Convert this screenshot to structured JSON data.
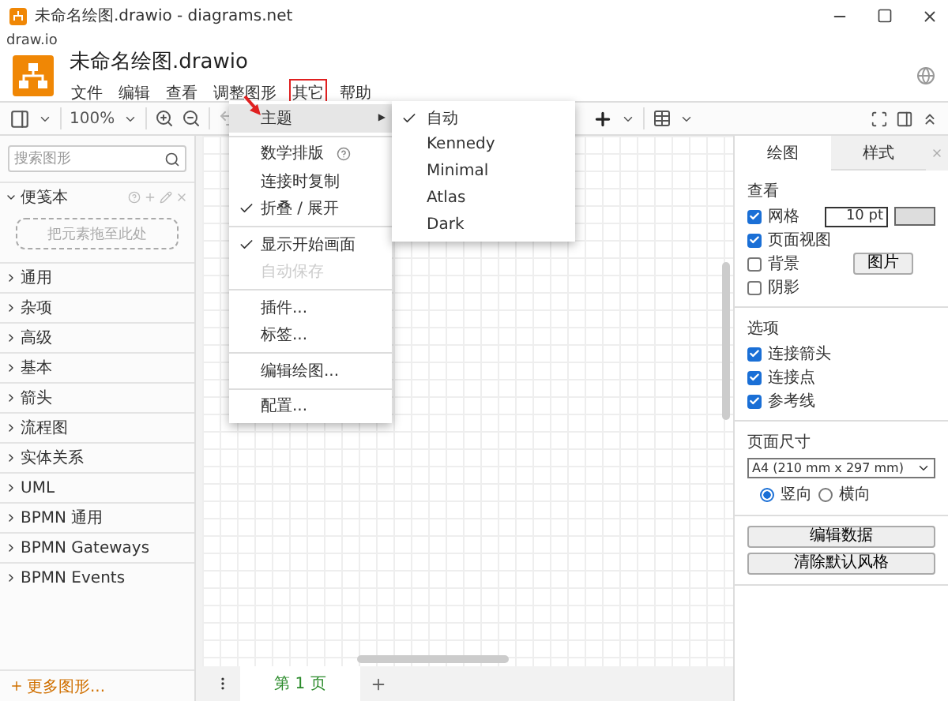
{
  "window": {
    "title": "未命名绘图.drawio - diagrams.net",
    "app_label": "draw.io"
  },
  "header": {
    "doc_title": "未命名绘图.drawio",
    "menu": [
      {
        "label": "文件",
        "selected": false
      },
      {
        "label": "编辑",
        "selected": false
      },
      {
        "label": "查看",
        "selected": false
      },
      {
        "label": "调整图形",
        "selected": false
      },
      {
        "label": "其它",
        "selected": true
      },
      {
        "label": "帮助",
        "selected": false
      }
    ]
  },
  "toolbar": {
    "zoom": "100%"
  },
  "sidebar": {
    "search": {
      "placeholder": "搜索图形"
    },
    "scratchpad": {
      "title": "便笺本",
      "hint": "把元素拖至此处"
    },
    "categories": [
      "通用",
      "杂项",
      "高级",
      "基本",
      "箭头",
      "流程图",
      "实体关系",
      "UML",
      "BPMN 通用",
      "BPMN Gateways",
      "BPMN Events"
    ],
    "more": "更多图形..."
  },
  "menu": [
    {
      "kind": "item",
      "label": "主题",
      "checked": false,
      "disabled": false,
      "submenu_arrow": "▶",
      "help": false,
      "selected": true
    },
    {
      "kind": "separator"
    },
    {
      "kind": "item",
      "label": "数学排版",
      "checked": false,
      "disabled": false,
      "help": true,
      "selected": false
    },
    {
      "kind": "item",
      "label": "连接时复制",
      "checked": false,
      "disabled": false,
      "help": false,
      "selected": false
    },
    {
      "kind": "item",
      "label": "折叠 / 展开",
      "checked": true,
      "disabled": false,
      "help": false,
      "selected": false
    },
    {
      "kind": "separator"
    },
    {
      "kind": "item",
      "label": "显示开始画面",
      "checked": true,
      "disabled": false,
      "help": false,
      "selected": false
    },
    {
      "kind": "item",
      "label": "自动保存",
      "checked": false,
      "disabled": true,
      "help": false,
      "selected": false
    },
    {
      "kind": "separator"
    },
    {
      "kind": "item",
      "label": "插件...",
      "checked": false,
      "disabled": false,
      "help": false,
      "selected": false
    },
    {
      "kind": "item",
      "label": "标签...",
      "checked": false,
      "disabled": false,
      "help": false,
      "selected": false
    },
    {
      "kind": "separator"
    },
    {
      "kind": "item",
      "label": "编辑绘图...",
      "checked": false,
      "disabled": false,
      "help": false,
      "selected": false
    },
    {
      "kind": "separator"
    },
    {
      "kind": "item",
      "label": "配置...",
      "checked": false,
      "disabled": false,
      "help": false,
      "selected": false
    }
  ],
  "submenu": [
    {
      "label": "自动",
      "checked": true
    },
    {
      "label": "Kennedy",
      "checked": false
    },
    {
      "label": "Minimal",
      "checked": false
    },
    {
      "label": "Atlas",
      "checked": false
    },
    {
      "label": "Dark",
      "checked": false
    }
  ],
  "format": {
    "tabs": [
      {
        "label": "绘图",
        "selected": true
      },
      {
        "label": "样式",
        "selected": false
      }
    ],
    "view": {
      "title": "查看",
      "options": [
        {
          "label": "网格",
          "checked": true
        },
        {
          "label": "页面视图",
          "checked": true
        },
        {
          "label": "背景",
          "checked": false
        },
        {
          "label": "阴影",
          "checked": false
        }
      ],
      "grid_size": "10 pt",
      "image_button": "图片"
    },
    "options": {
      "title": "选项",
      "options": [
        {
          "label": "连接箭头",
          "checked": true
        },
        {
          "label": "连接点",
          "checked": true
        },
        {
          "label": "参考线",
          "checked": true
        }
      ]
    },
    "paper": {
      "title": "页面尺寸",
      "size": "A4 (210 mm x 297 mm)",
      "orientation": [
        {
          "label": "竖向",
          "selected": true
        },
        {
          "label": "横向",
          "selected": false
        }
      ]
    },
    "buttons": [
      "编辑数据",
      "清除默认风格"
    ]
  },
  "pages": [
    {
      "label": "第 1 页",
      "selected": true
    }
  ]
}
